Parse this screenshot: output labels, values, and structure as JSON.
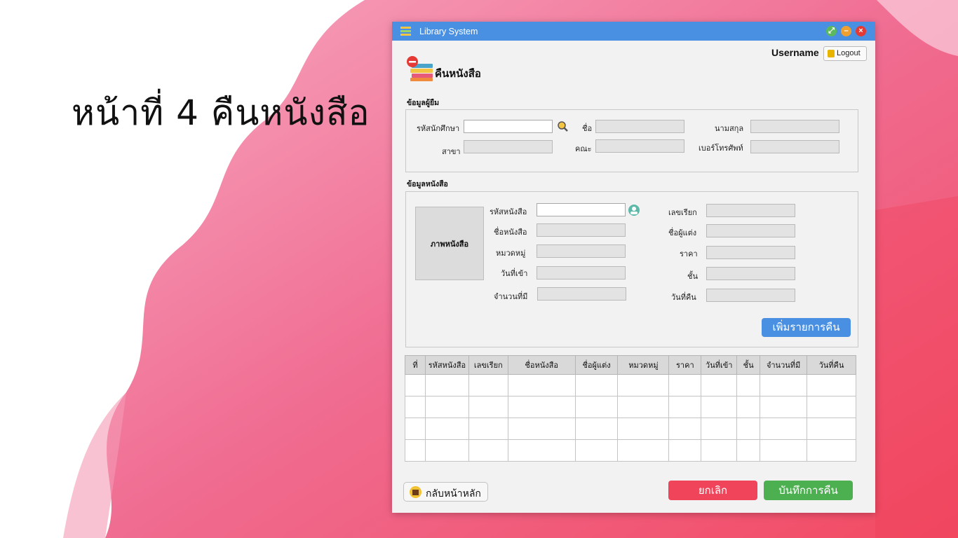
{
  "slide": {
    "title": "หน้าที่ 4 คืนหนังสือ"
  },
  "window": {
    "title": "Library System",
    "controls": {
      "restore": "",
      "minimize": "",
      "close": ""
    }
  },
  "user": {
    "name": "Username",
    "logout_label": "Logout"
  },
  "page": {
    "heading": "คืนหนังสือ",
    "icon": "books-minus-icon"
  },
  "borrower": {
    "section_label": "ข้อมูลผู้ยืม",
    "student_id_label": "รหัสนักศึกษา",
    "first_name_label": "ชื่อ",
    "last_name_label": "นามสกุล",
    "major_label": "สาขา",
    "faculty_label": "คณะ",
    "phone_label": "เบอร์โทรศัพท์",
    "search_icon": "search-icon"
  },
  "book": {
    "section_label": "ข้อมูลหนังสือ",
    "image_placeholder": "ภาพหนังสือ",
    "book_id_label": "รหัสหนังสือ",
    "book_name_label": "ชื่อหนังสือ",
    "category_label": "หมวดหมู่",
    "date_in_label": "วันที่เข้า",
    "quantity_label": "จำนวนที่มี",
    "call_number_label": "เลขเรียก",
    "author_label": "ชื่อผู้แต่ง",
    "price_label": "ราคา",
    "shelf_label": "ชั้น",
    "return_date_label": "วันที่คืน",
    "add_button_label": "เพิ่มรายการคืน"
  },
  "table": {
    "columns": [
      "ที่",
      "รหัสหนังสือ",
      "เลขเรียก",
      "ชื่อหนังสือ",
      "ชื่อผู้แต่ง",
      "หมวดหมู่",
      "ราคา",
      "วันที่เข้า",
      "ชั้น",
      "จำนวนที่มี",
      "วันที่คืน"
    ],
    "empty_rows": 4
  },
  "footer": {
    "home_label": "กลับหน้าหลัก",
    "cancel_label": "ยกเลิก",
    "save_label": "บันทึกการคืน"
  },
  "colors": {
    "titlebar": "#4a90e2",
    "add_button": "#4a90e2",
    "cancel_button": "#ef4459",
    "save_button": "#4caf50",
    "brush_pink": "#f06c91"
  }
}
